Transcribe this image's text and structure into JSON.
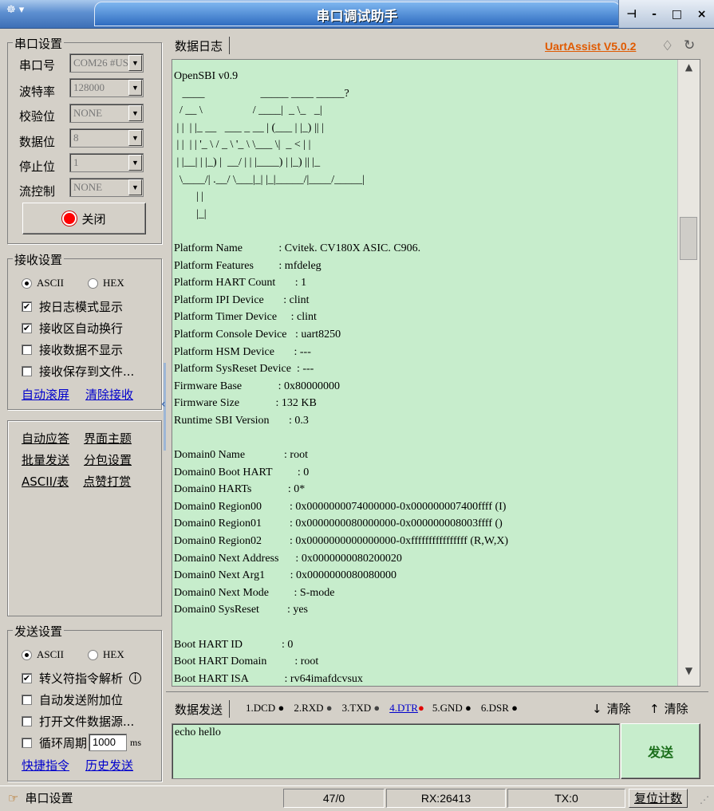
{
  "window": {
    "title": "串口调试助手",
    "controls": [
      "-",
      "□",
      "×"
    ]
  },
  "serial": {
    "title": "串口设置",
    "port_label": "串口号",
    "port_value": "COM26 #US",
    "baud_label": "波特率",
    "baud_value": "128000",
    "parity_label": "校验位",
    "parity_value": "NONE",
    "databits_label": "数据位",
    "databits_value": "8",
    "stopbits_label": "停止位",
    "stopbits_value": "1",
    "flow_label": "流控制",
    "flow_value": "NONE",
    "close_label": "关闭",
    "indicator_color": "#ff0000"
  },
  "receive": {
    "title": "接收设置",
    "ascii": "ASCII",
    "hex": "HEX",
    "opt_log_mode": "按日志模式显示",
    "opt_autowrap": "接收区自动换行",
    "opt_nodisplay": "接收数据不显示",
    "opt_savefile": "接收保存到文件...",
    "link_autoscroll": "自动滚屏",
    "link_clear": "清除接收"
  },
  "tools": {
    "auto_reply": "自动应答",
    "theme": "界面主题",
    "batch_send": "批量发送",
    "packet": "分包设置",
    "ascii_table": "ASCII/表",
    "donate": "点赞打赏"
  },
  "send": {
    "title": "发送设置",
    "ascii": "ASCII",
    "hex": "HEX",
    "opt_escape": "转义符指令解析",
    "opt_append": "自动发送附加位",
    "opt_file": "打开文件数据源...",
    "opt_cycle": "循环周期",
    "cycle_value": "1000",
    "cycle_unit": "ms",
    "link_shortcut": "快捷指令",
    "link_history": "历史发送"
  },
  "log": {
    "tab": "数据日志",
    "brand": "UartAssist V5.0.2",
    "brand_color": "#e05a00",
    "lines": [
      "OpenSBI v0.9",
      "   ____                    _____ ____ _____?",
      "  / __ \\                  / ____|  _ \\_   _|",
      " | |  | |_ __   ___ _ __ | (___ | |_) || |",
      " | |  | | '_ \\ / _ \\ '_ \\ \\___ \\|  _ < | |",
      " | |__| | |_) |  __/ | | |____) | |_) || |_",
      "  \\____/| .__/ \\___|_| |_|_____/|____/_____|",
      "        | |",
      "        |_|",
      "",
      "Platform Name             : Cvitek. CV180X ASIC. C906.",
      "Platform Features         : mfdeleg",
      "Platform HART Count       : 1",
      "Platform IPI Device       : clint",
      "Platform Timer Device     : clint",
      "Platform Console Device   : uart8250",
      "Platform HSM Device       : ---",
      "Platform SysReset Device  : ---",
      "Firmware Base             : 0x80000000",
      "Firmware Size             : 132 KB",
      "Runtime SBI Version       : 0.3",
      "",
      "Domain0 Name              : root",
      "Domain0 Boot HART         : 0",
      "Domain0 HARTs             : 0*",
      "Domain0 Region00          : 0x0000000074000000-0x000000007400ffff (I)",
      "Domain0 Region01          : 0x0000000080000000-0x000000008003ffff ()",
      "Domain0 Region02          : 0x0000000000000000-0xffffffffffffffff (R,W,X)",
      "Domain0 Next Address      : 0x0000000080200020",
      "Domain0 Next Arg1         : 0x0000000080080000",
      "Domain0 Next Mode         : S-mode",
      "Domain0 SysReset          : yes",
      "",
      "Boot HART ID              : 0",
      "Boot HART Domain          : root",
      "Boot HART ISA             : rv64imafdcvsux"
    ]
  },
  "sendarea": {
    "tab": "数据发送",
    "pin1": "1.DCD",
    "pin2": "2.RXD",
    "pin3": "3.TXD",
    "pin4": "4.DTR",
    "pin5": "5.GND",
    "pin6": "6.DSR",
    "clear1": "清除",
    "clear2": "清除",
    "text": "echo hello",
    "send_button": "发送"
  },
  "status": {
    "label": "串口设置",
    "count": "47/0",
    "rx": "RX:26413",
    "tx": "TX:0",
    "reset": "复位计数"
  }
}
